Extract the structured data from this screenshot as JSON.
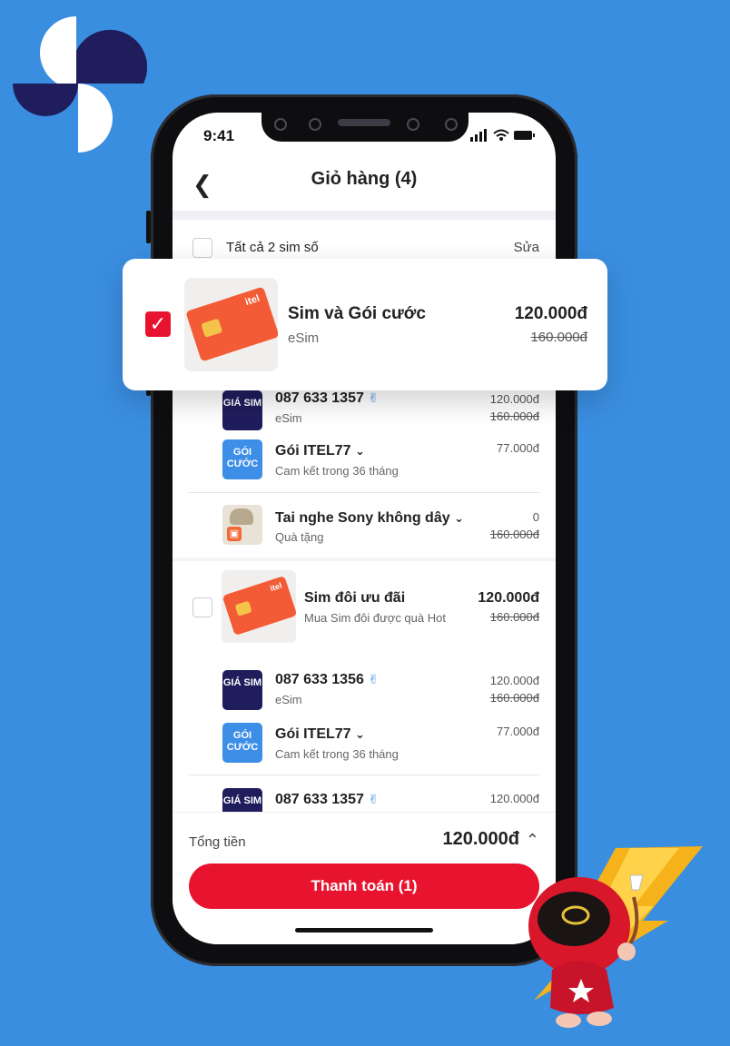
{
  "status": {
    "time": "9:41"
  },
  "nav": {
    "title": "Giỏ hàng (4)"
  },
  "cart_header": {
    "select_all_label": "Tất cả 2 sim số",
    "edit_label": "Sửa"
  },
  "popup": {
    "name": "Sim và Gói cước",
    "sub": "eSim",
    "price": "120.000đ",
    "original_price": "160.000đ",
    "checked": true,
    "card_brand": "itel"
  },
  "group1": {
    "sim": {
      "badge": "GIÁ SIM",
      "number": "087 633 1357",
      "sub": "eSim",
      "price": "120.000đ",
      "original_price": "160.000đ"
    },
    "plan": {
      "badge": "GÓI CƯỚC",
      "name": "Gói ITEL77",
      "sub": "Cam kết trong 36 tháng",
      "price": "77.000đ"
    },
    "gift": {
      "name": "Tai nghe Sony không dây",
      "sub": "Quà tặng",
      "price": "0",
      "original_price": "160.000đ"
    }
  },
  "group2": {
    "product": {
      "name": "Sim đôi ưu đãi",
      "sub": "Mua Sim đôi được quà Hot",
      "price": "120.000đ",
      "original_price": "160.000đ",
      "card_brand": "itel"
    },
    "sim": {
      "badge": "GIÁ SIM",
      "number": "087 633 1356",
      "sub": "eSim",
      "price": "120.000đ",
      "original_price": "160.000đ"
    },
    "plan": {
      "badge": "GÓI CƯỚC",
      "name": "Gói ITEL77",
      "sub": "Cam kết trong 36 tháng",
      "price": "77.000đ"
    },
    "sim2": {
      "badge": "GIÁ SIM",
      "number": "087 633 1357",
      "price": "120.000đ"
    }
  },
  "footer": {
    "total_label": "Tổng tiền",
    "total_value": "120.000đ",
    "pay_label": "Thanh toán (1)"
  },
  "colors": {
    "background": "#3a8ee0",
    "accent": "#e8142f",
    "navy": "#1f1d5c",
    "blue_badge": "#3d8ee6"
  }
}
